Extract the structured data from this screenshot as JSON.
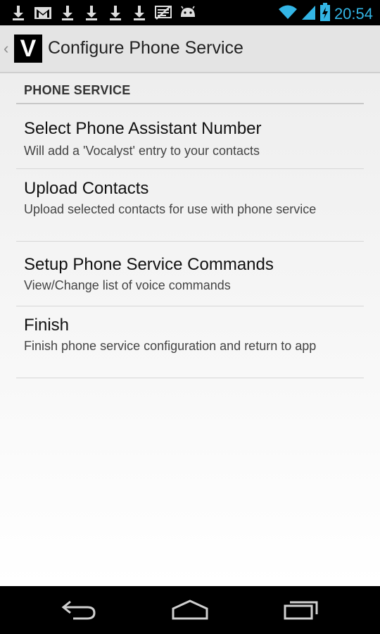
{
  "status_bar": {
    "time": "20:54",
    "left_icons": [
      "download-icon",
      "gmail-icon",
      "download-icon",
      "download-icon",
      "download-icon",
      "download-icon",
      "sms-blocked-icon",
      "android-icon"
    ],
    "right_icons": [
      "wifi-icon",
      "cell-signal-icon",
      "battery-charging-icon"
    ],
    "accent_color": "#33b5e5"
  },
  "action_bar": {
    "logo_letter": "V",
    "title": "Configure Phone Service"
  },
  "section": {
    "header": "PHONE SERVICE"
  },
  "preferences": [
    {
      "title": "Select Phone Assistant Number",
      "summary": "Will add a 'Vocalyst' entry to your contacts"
    },
    {
      "title": "Upload Contacts",
      "summary": "Upload selected contacts for use with phone service"
    },
    {
      "title": "Setup Phone Service Commands",
      "summary": "View/Change list of voice commands"
    },
    {
      "title": "Finish",
      "summary": "Finish phone service configuration and return to app"
    }
  ],
  "nav_bar": {
    "buttons": [
      "back-icon",
      "home-icon",
      "recent-apps-icon"
    ]
  }
}
